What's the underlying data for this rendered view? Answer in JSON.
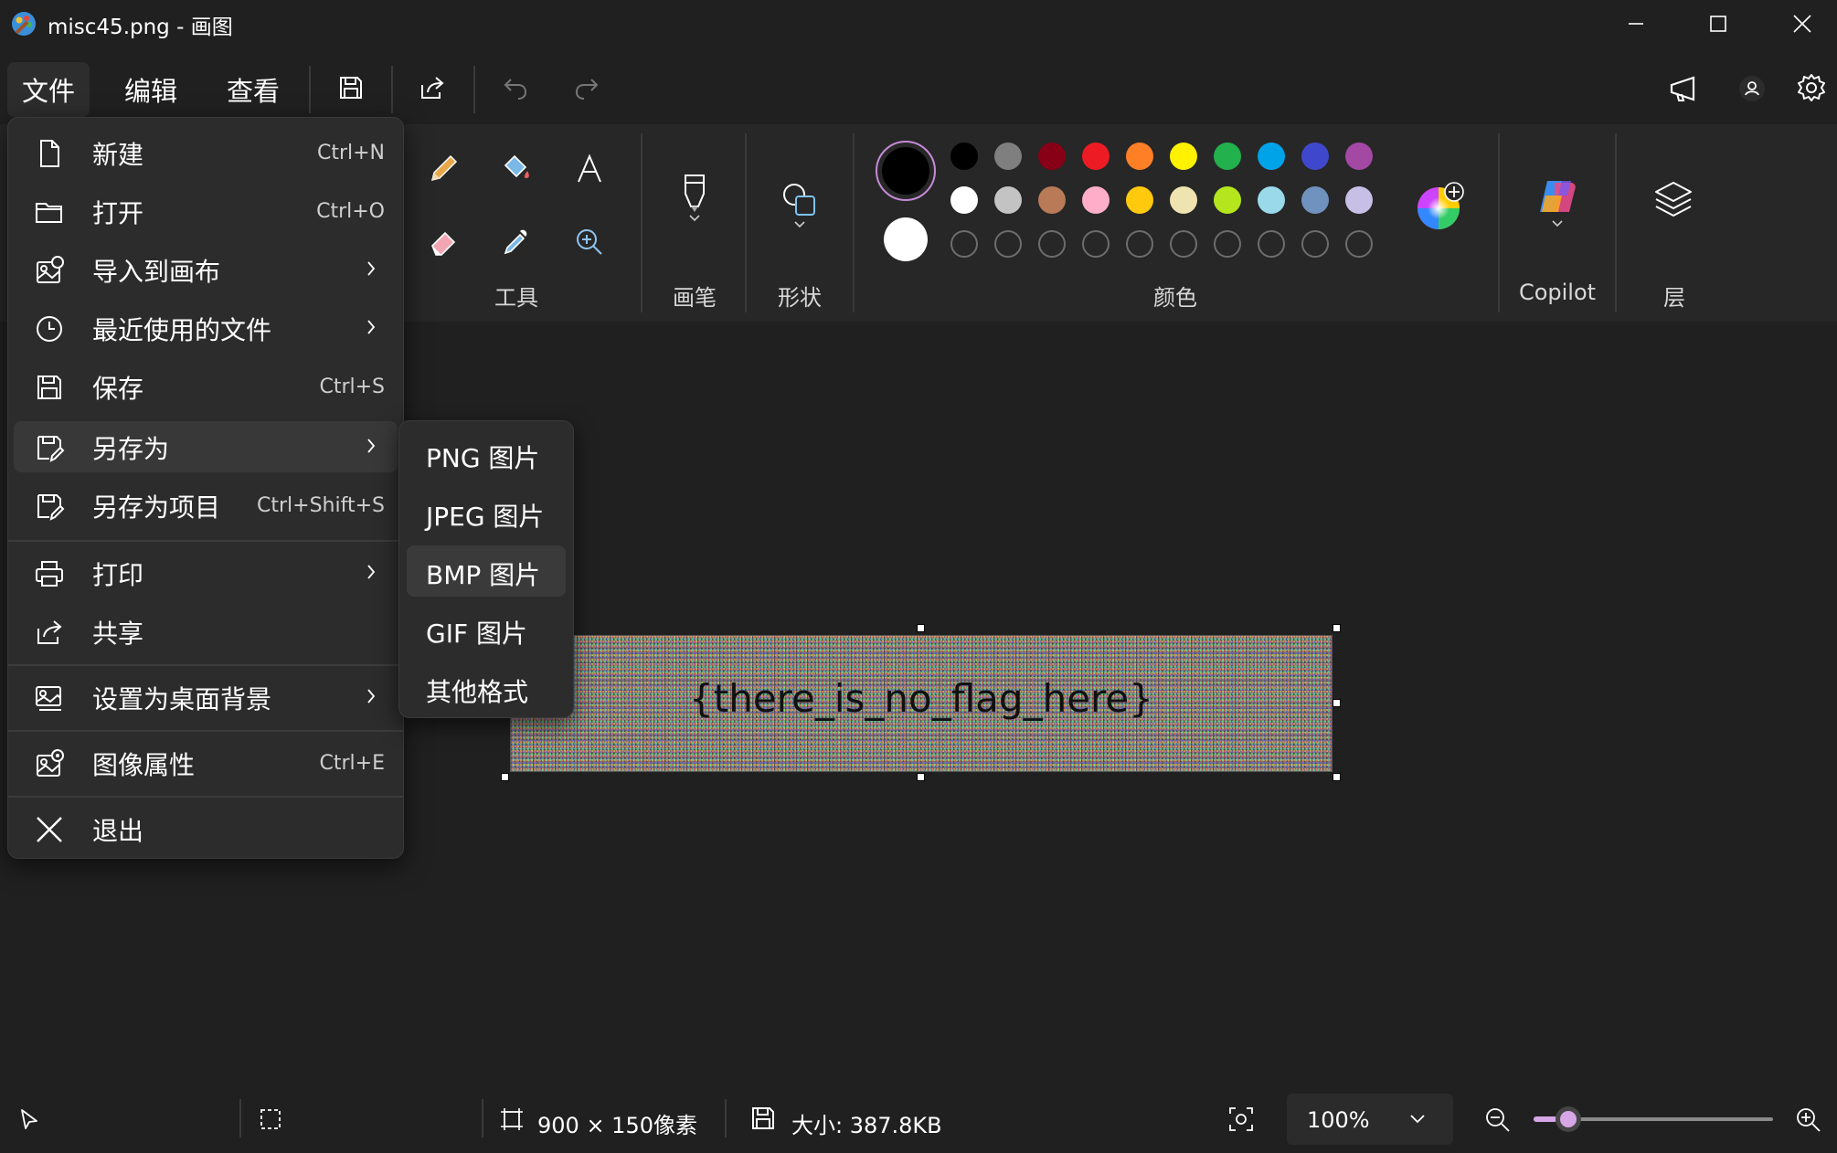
{
  "window": {
    "title": "misc45.png - 画图",
    "controls": [
      "minimize",
      "maximize",
      "close"
    ]
  },
  "menubar": {
    "items": [
      {
        "label": "文件",
        "active": true
      },
      {
        "label": "编辑"
      },
      {
        "label": "查看"
      }
    ]
  },
  "toolbar": {
    "icons": [
      "save-icon",
      "share-icon",
      "undo-icon",
      "redo-icon"
    ],
    "right_icons": [
      "feedback-megaphone-icon",
      "account-icon",
      "settings-icon"
    ]
  },
  "ribbon": {
    "tools_label": "工具",
    "brush_label": "画笔",
    "shapes_label": "形状",
    "colors_label": "颜色",
    "copilot_label": "Copilot",
    "layers_label": "层",
    "primary_color": "#000000",
    "secondary_color": "#ffffff",
    "palette_row1": [
      "#000000",
      "#7f7f7f",
      "#880015",
      "#ed1c24",
      "#ff7f27",
      "#fff200",
      "#22b14c",
      "#00a2e8",
      "#3f48cc",
      "#a349a4"
    ],
    "palette_row2": [
      "#ffffff",
      "#c3c3c3",
      "#b97a57",
      "#ffaec9",
      "#ffc90e",
      "#efe4b0",
      "#b5e61d",
      "#99d9ea",
      "#7092be",
      "#c8bfe7"
    ],
    "palette_row3_empty_count": 10
  },
  "file_menu": {
    "items": [
      {
        "label": "新建",
        "shortcut": "Ctrl+N",
        "icon": "new-file-icon"
      },
      {
        "label": "打开",
        "shortcut": "Ctrl+O",
        "icon": "folder-icon"
      },
      {
        "label": "导入到画布",
        "submenu": true,
        "icon": "import-image-icon"
      },
      {
        "label": "最近使用的文件",
        "submenu": true,
        "icon": "clock-icon"
      },
      {
        "label": "保存",
        "shortcut": "Ctrl+S",
        "icon": "save-icon"
      },
      {
        "label": "另存为",
        "submenu": true,
        "icon": "save-as-icon",
        "highlighted": true
      },
      {
        "label": "另存为项目",
        "shortcut": "Ctrl+Shift+S",
        "icon": "save-project-icon"
      },
      {
        "label": "打印",
        "submenu": true,
        "icon": "printer-icon"
      },
      {
        "label": "共享",
        "icon": "share-icon"
      },
      {
        "label": "设置为桌面背景",
        "submenu": true,
        "icon": "desktop-background-icon"
      },
      {
        "label": "图像属性",
        "shortcut": "Ctrl+E",
        "icon": "image-properties-icon"
      },
      {
        "label": "退出",
        "icon": "close-icon"
      }
    ]
  },
  "save_as_submenu": {
    "items": [
      {
        "label": "PNG 图片"
      },
      {
        "label": "JPEG 图片"
      },
      {
        "label": "BMP 图片",
        "highlighted": true
      },
      {
        "label": "GIF 图片"
      },
      {
        "label": "其他格式"
      }
    ]
  },
  "canvas": {
    "image_text": "{there_is_no_flag_here}"
  },
  "statusbar": {
    "dimensions": "900 × 150像素",
    "file_size": "大小: 387.8KB",
    "zoom": "100%",
    "zoom_slider_fraction": 0.1
  }
}
